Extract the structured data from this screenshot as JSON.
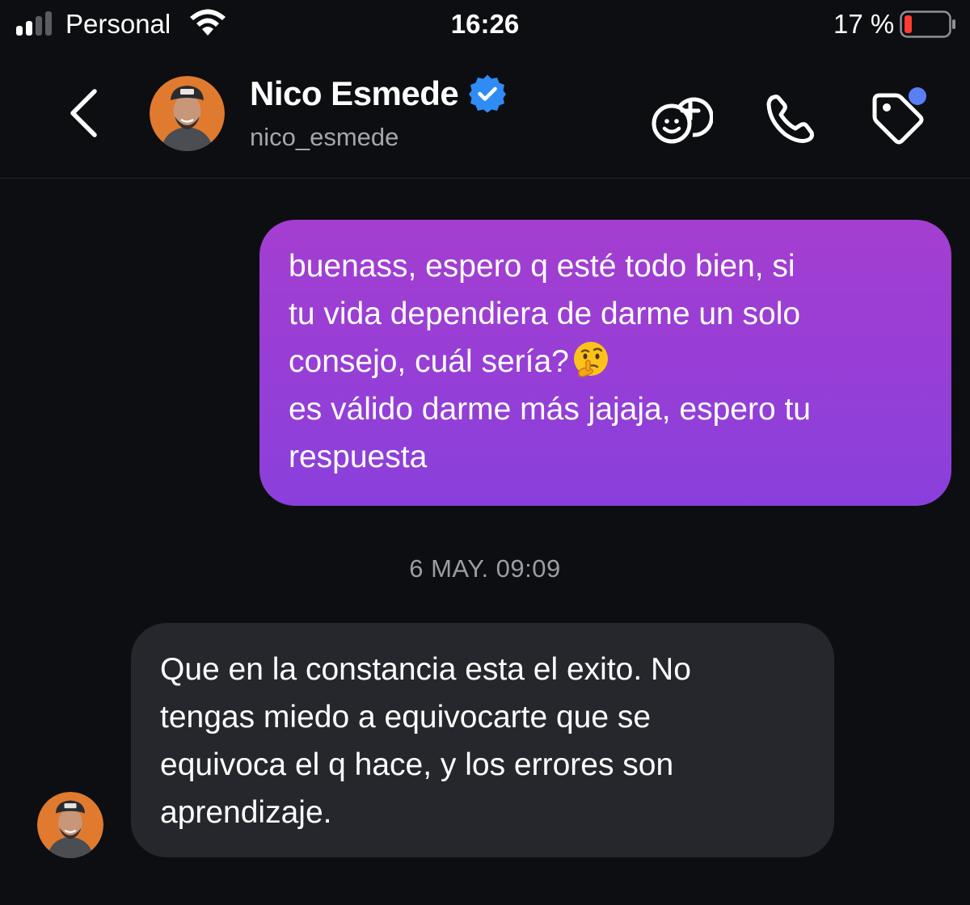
{
  "status_bar": {
    "carrier": "Personal",
    "time": "16:26",
    "battery_percent": "17 %",
    "signal_bars_active": 2,
    "battery_level": 0.17,
    "battery_color": "#ff3b30"
  },
  "header": {
    "contact_name": "Nico Esmede",
    "username": "nico_esmede",
    "verified": true,
    "verified_color": "#2f8cf5",
    "tag_notification_dot_color": "#5b7df5"
  },
  "conversation": {
    "outgoing_message": {
      "line_1": "buenass, espero q esté todo bien, si",
      "line_2": "tu vida dependiera de darme un solo",
      "line_3": "consejo, cuál sería?",
      "line_4": "es válido darme más jajaja, espero tu",
      "line_5": "respuesta",
      "emoji": "thinking-face-emoji"
    },
    "timestamp": "6 MAY. 09:09",
    "incoming_message": {
      "line_1": "Que en la constancia esta el exito. No",
      "line_2": "tengas miedo a equivocarte que se",
      "line_3": "equivoca el q hace, y los errores son",
      "line_4": "aprendizaje."
    }
  },
  "colors": {
    "background": "#0d0e12",
    "outgoing_bubble_top": "#a43ed0",
    "outgoing_bubble_bottom": "#8a3fdc",
    "incoming_bubble": "#25272d",
    "avatar_background": "#e07a2e"
  }
}
